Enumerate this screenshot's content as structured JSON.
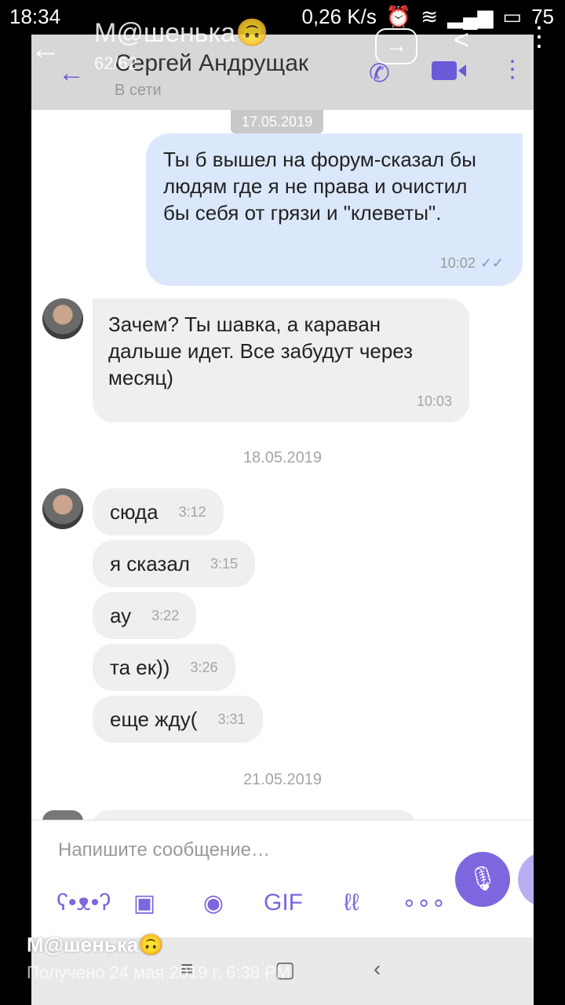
{
  "status_bar": {
    "time": "18:34",
    "network_speed": "0,26 K/s",
    "battery": "75"
  },
  "viewer": {
    "title": "М@шенька🙃",
    "counter": "62/62",
    "back_icon": "arrow-left-icon",
    "forward_icon": "forward-icon",
    "share_icon": "share-icon",
    "more_icon": "more-vertical-icon",
    "caption_name": "М@шенька🙃",
    "caption_received": "Получено 24 мая 2019 г. 6:38 PM"
  },
  "chat_header": {
    "contact_name": "Сергей Андрущак",
    "status": "В сети",
    "accent": "#6b5ad8"
  },
  "messages": {
    "date1": "17.05.2019",
    "out1": {
      "text": "Ты б вышел на форум-сказал бы людям где я не права и очистил бы себя от грязи и \"клеветы\".",
      "time": "10:02",
      "ticks": "✓✓"
    },
    "in1": {
      "text": "Зачем? Ты шавка, а караван дальше идет. Все забудут через месяц)",
      "time": "10:03"
    },
    "date2": "18.05.2019",
    "group": [
      {
        "text": "сюда",
        "time": "3:12"
      },
      {
        "text": "я сказал",
        "time": "3:15"
      },
      {
        "text": "ау",
        "time": "3:22"
      },
      {
        "text": "та ек))",
        "time": "3:26"
      },
      {
        "text": "еще жду(",
        "time": "3:31"
      }
    ],
    "date3": "21.05.2019"
  },
  "composer": {
    "placeholder": "Напишите сообщение…",
    "tools": [
      "sticker-icon",
      "gallery-icon",
      "camera-icon",
      "gif-icon",
      "doodle-icon",
      "more-icon"
    ],
    "mic_icon": "microphone-icon",
    "mic_color": "#7d66de"
  }
}
